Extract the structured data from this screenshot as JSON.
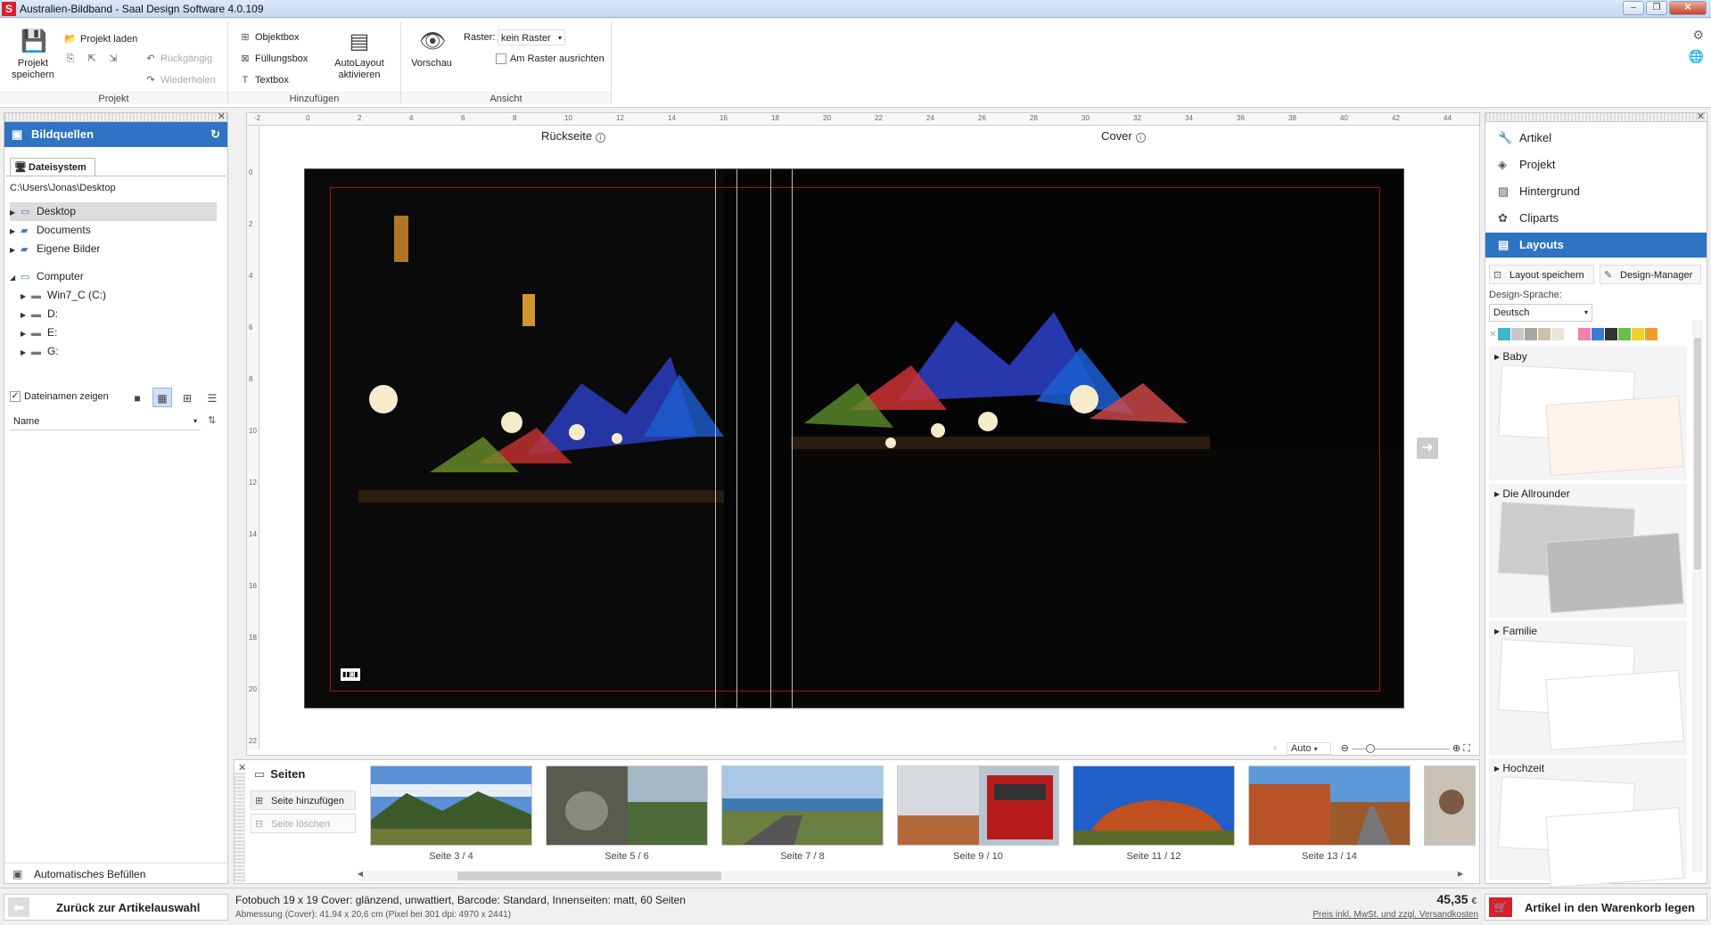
{
  "window": {
    "title": "Australien-Bildband - Saal Design Software 4.0.109",
    "logo_letter": "S"
  },
  "ribbon": {
    "projekt": {
      "save": "Projekt speichern",
      "load": "Projekt laden",
      "undo": "Rückgängig",
      "redo": "Wiederholen",
      "group": "Projekt"
    },
    "hinzufuegen": {
      "objektbox": "Objektbox",
      "fuellungsbox": "Füllungsbox",
      "textbox": "Textbox",
      "autolayout": "AutoLayout aktivieren",
      "group": "Hinzufügen"
    },
    "ansicht": {
      "vorschau": "Vorschau",
      "raster_label": "Raster:",
      "raster_value": "kein Raster",
      "am_raster": "Am Raster ausrichten",
      "group": "Ansicht"
    }
  },
  "left_panel": {
    "title": "Bildquellen",
    "tab": "Dateisystem",
    "path": "C:\\Users\\Jonas\\Desktop",
    "tree": [
      {
        "label": "Desktop",
        "level": 0,
        "selected": true,
        "icon": "monitor-icon"
      },
      {
        "label": "Documents",
        "level": 0,
        "icon": "folder-icon"
      },
      {
        "label": "Eigene Bilder",
        "level": 0,
        "icon": "folder-icon"
      },
      {
        "label": "Computer",
        "level": 0,
        "icon": "computer-icon"
      },
      {
        "label": "Win7_C (C:)",
        "level": 1,
        "icon": "drive-icon"
      },
      {
        "label": "D:",
        "level": 1,
        "icon": "drive-icon"
      },
      {
        "label": "E:",
        "level": 1,
        "icon": "drive-icon"
      },
      {
        "label": "G:",
        "level": 1,
        "icon": "drive-icon"
      }
    ],
    "show_filenames": "Dateinamen zeigen",
    "sort": "Name",
    "autofill": "Automatisches Befüllen"
  },
  "canvas": {
    "back_label": "Rückseite",
    "cover_label": "Cover",
    "ruler_h": [
      "-2",
      "0",
      "2",
      "4",
      "6",
      "8",
      "10",
      "12",
      "14",
      "16",
      "18",
      "20",
      "22",
      "24",
      "26",
      "28",
      "30",
      "32",
      "34",
      "36",
      "38",
      "40",
      "42",
      "44"
    ],
    "ruler_v": [
      "0",
      "2",
      "4",
      "6",
      "8",
      "10",
      "12",
      "14",
      "16",
      "18",
      "20",
      "22"
    ],
    "zoom": "Auto",
    "barcode": "▮▮▯▮"
  },
  "pages": {
    "title": "Seiten",
    "add": "Seite hinzufügen",
    "delete": "Seite löschen",
    "thumbs": [
      "Seite 3 / 4",
      "Seite 5 / 6",
      "Seite 7 / 8",
      "Seite 9 / 10",
      "Seite 11 / 12",
      "Seite 13 / 14"
    ]
  },
  "right_panel": {
    "nav": [
      {
        "label": "Artikel",
        "icon": "wrench-icon"
      },
      {
        "label": "Projekt",
        "icon": "layers-icon"
      },
      {
        "label": "Hintergrund",
        "icon": "image-icon"
      },
      {
        "label": "Cliparts",
        "icon": "clipart-icon"
      },
      {
        "label": "Layouts",
        "icon": "layout-icon",
        "active": true
      }
    ],
    "save_layout": "Layout speichern",
    "design_manager": "Design-Manager",
    "lang_label": "Design-Sprache:",
    "lang_value": "Deutsch",
    "swatches": [
      "#3fb6c9",
      "#c8c8c8",
      "#a8a8a0",
      "#c9c2a6",
      "#ebe6d5",
      "#ffffff",
      "#ee82b3",
      "#3a7bd5",
      "#333333",
      "#6abf4b",
      "#f2d12e",
      "#f39c2c"
    ],
    "categories": [
      "Baby",
      "Die Allrounder",
      "Familie",
      "Hochzeit"
    ]
  },
  "status": {
    "back": "Zurück zur Artikelauswahl",
    "product": "Fotobuch 19 x 19 Cover: glänzend, unwattiert, Barcode: Standard, Innenseiten: matt, 60 Seiten",
    "dims": "Abmessung (Cover): 41,94 x 20,6 cm (Pixel bei 301 dpi: 4970 x 2441)",
    "price": "45,35",
    "currency": "€",
    "price_note": "Preis inkl. MwSt. und zzgl. Versandkosten",
    "cart": "Artikel in den Warenkorb legen"
  }
}
